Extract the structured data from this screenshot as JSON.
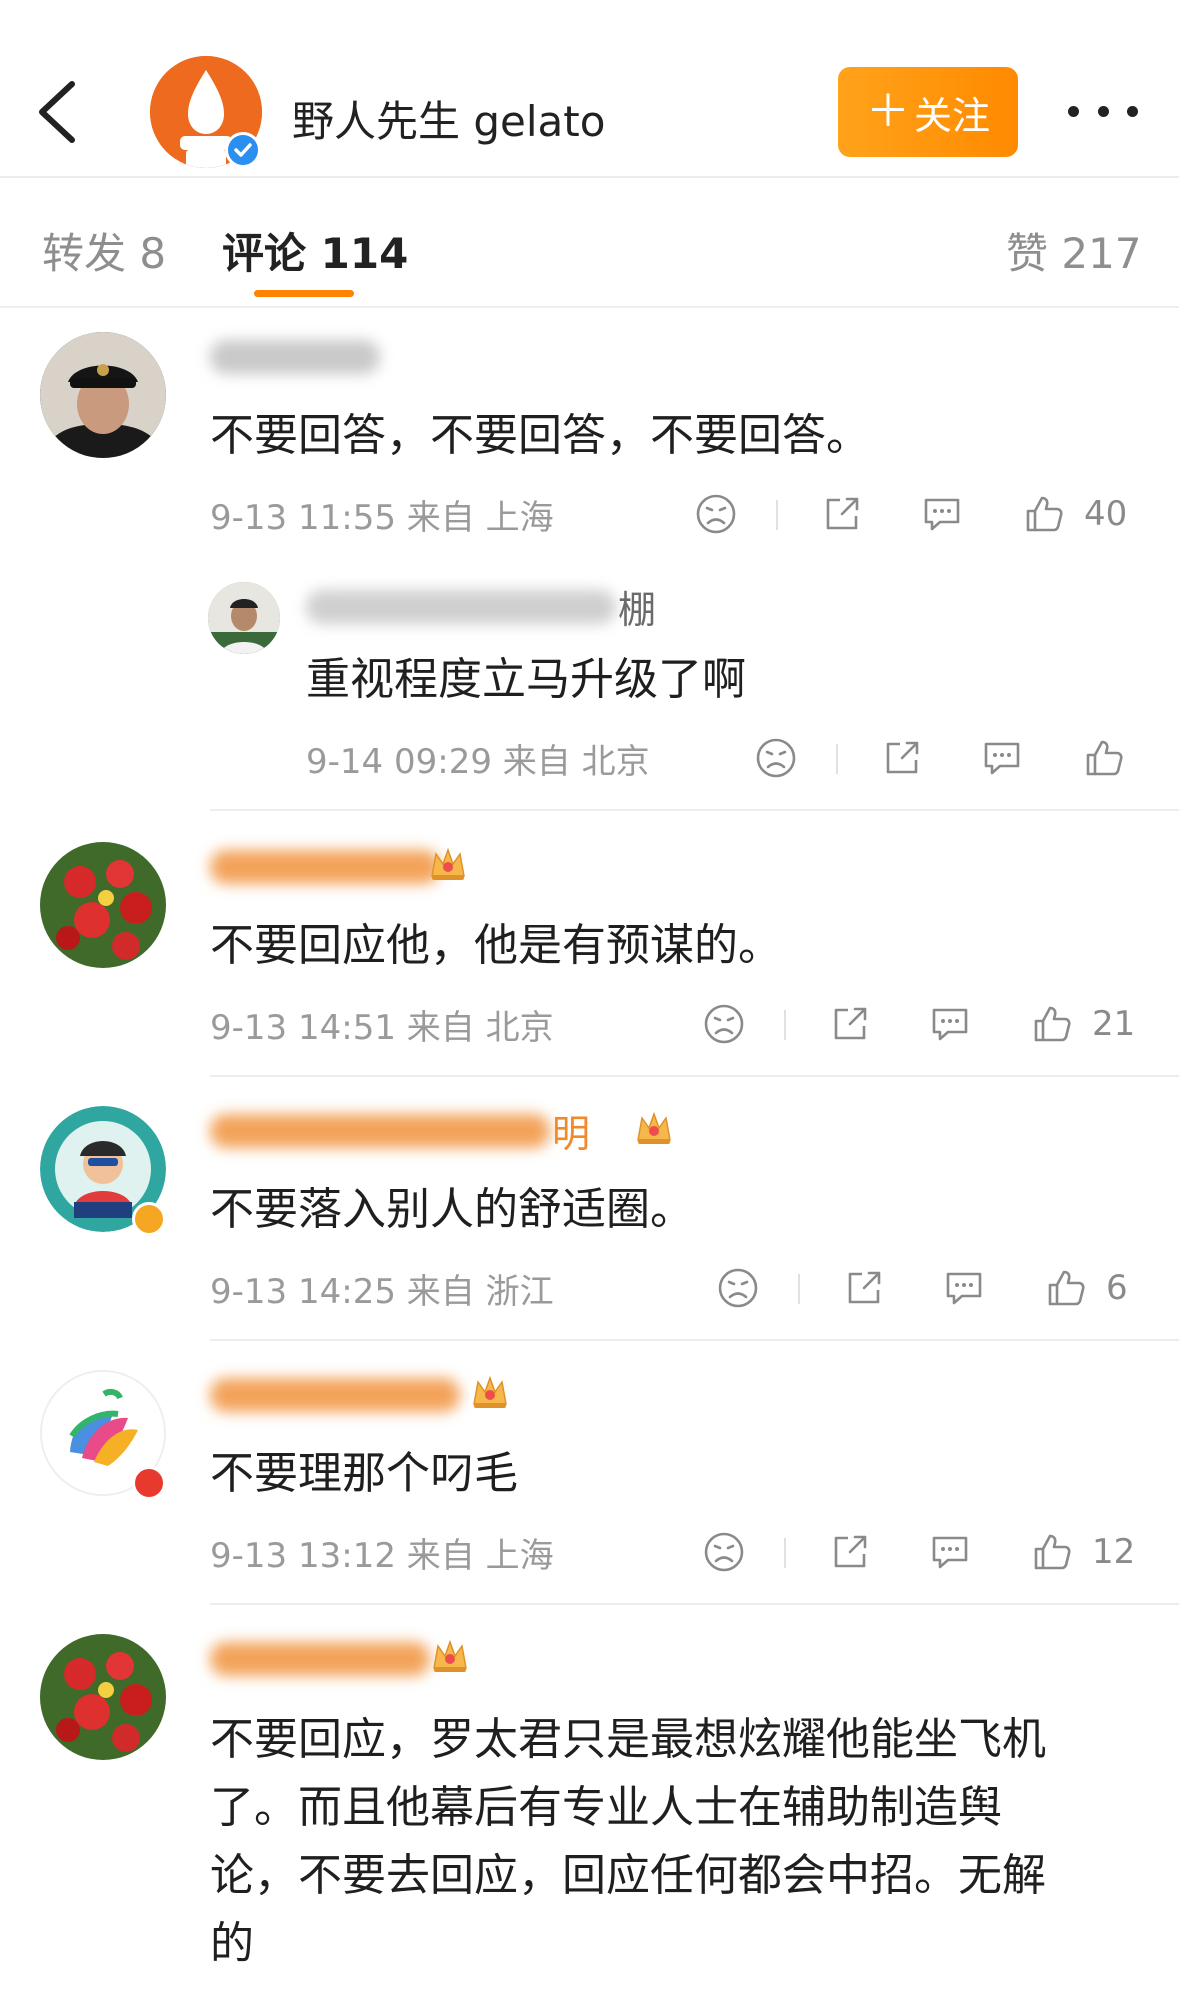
{
  "header": {
    "account_name": "野人先生 gelato",
    "follow_plus": "＋",
    "follow_label": "关注",
    "back_icon": "chevron-left-icon",
    "more_icon": "more-horizontal-icon",
    "accent_color": "#ff8200",
    "avatar_color": "#ee6a1e",
    "verified_color": "#2a8ff0"
  },
  "tabs": {
    "repost": "转发 8",
    "comment": "评论 114",
    "like": "赞 217"
  },
  "comments": [
    {
      "text": "不要回答，不要回答，不要回答。",
      "time": "9-13 11:55 来自 上海",
      "likes": "40",
      "replies": [
        {
          "text": "重视程度立马升级了啊",
          "time": "9-14 09:29 来自 北京",
          "name_tail": "棚"
        }
      ]
    },
    {
      "text": "不要回应他，他是有预谋的。",
      "time": "9-13 14:51 来自 北京",
      "likes": "21"
    },
    {
      "text": "不要落入别人的舒适圈。",
      "time": "9-13 14:25 来自 浙江",
      "likes": "6",
      "name_tail": "明"
    },
    {
      "text": "不要理那个叼毛",
      "time": "9-13 13:12 来自 上海",
      "likes": "12"
    },
    {
      "lines": [
        "不要回应，罗太君只是最想炫耀他能坐飞机",
        "了。而且他幕后有专业人士在辅助制造舆",
        "论，不要去回应，回应任何都会中招。无解",
        "的"
      ]
    }
  ]
}
